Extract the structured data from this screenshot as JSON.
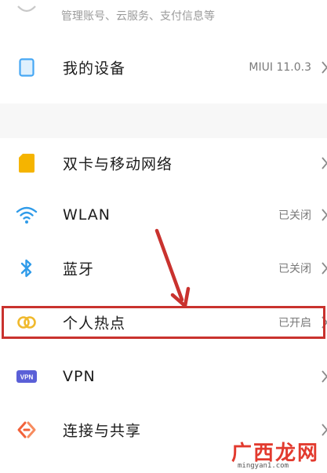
{
  "account": {
    "subtitle": "管理账号、云服务、支付信息等"
  },
  "device": {
    "label": "我的设备",
    "value": "MIUI 11.0.3"
  },
  "settings": {
    "dual_sim": {
      "label": "双卡与移动网络"
    },
    "wlan": {
      "label": "WLAN",
      "value": "已关闭"
    },
    "bluetooth": {
      "label": "蓝牙",
      "value": "已关闭"
    },
    "hotspot": {
      "label": "个人热点",
      "value": "已开启"
    },
    "vpn": {
      "label": "VPN",
      "badge": "VPN"
    },
    "connection": {
      "label": "连接与共享"
    }
  },
  "watermark": {
    "brand": "广西龙网",
    "domain": "mingyan1.com"
  },
  "colors": {
    "device_icon": "#46a7f4",
    "sim_icon": "#f5b400",
    "wifi_icon": "#2f9be9",
    "bluetooth_icon": "#2f9be9",
    "hotspot_icon": "#f0b92d",
    "vpn_icon": "#5a5fd7",
    "connect_icon": "#f2623a",
    "highlight": "#c9322e",
    "arrow": "#c9322e"
  }
}
